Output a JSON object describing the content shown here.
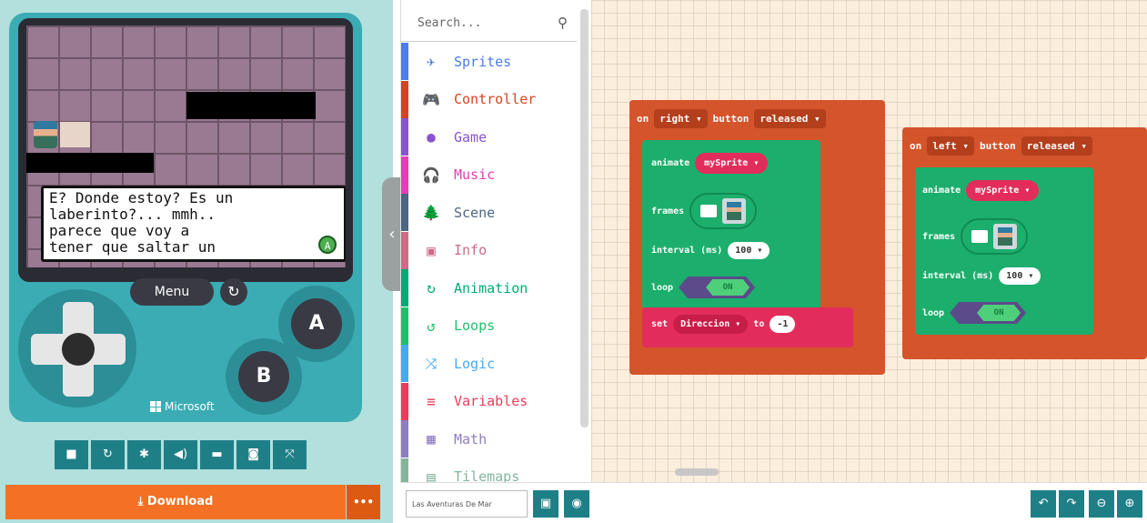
{
  "simulator": {
    "dialog_lines": [
      "E? Donde estoy? Es un",
      "laberinto?... mmh..",
      "parece que voy a",
      "tener que saltar un"
    ],
    "dialog_button": "A",
    "menu_label": "Menu",
    "button_a": "A",
    "button_b": "B",
    "brand": "Microsoft",
    "toolbar_icons": [
      "stop-icon",
      "restart-icon",
      "debug-icon",
      "sound-icon",
      "keyboard-icon",
      "screenshot-icon",
      "fullscreen-icon"
    ],
    "download_label": "Download",
    "more_label": "•••"
  },
  "toolbox": {
    "search_placeholder": "Search...",
    "categories": [
      {
        "label": "Sprites",
        "color": "#4b7bec",
        "icon": "✈"
      },
      {
        "label": "Controller",
        "color": "#d54322",
        "icon": "🎮"
      },
      {
        "label": "Game",
        "color": "#8854d0",
        "icon": "●"
      },
      {
        "label": "Music",
        "color": "#e63cb5",
        "icon": "🎧"
      },
      {
        "label": "Scene",
        "color": "#4b6584",
        "icon": "🌲"
      },
      {
        "label": "Info",
        "color": "#cf6a87",
        "icon": "▣"
      },
      {
        "label": "Animation",
        "color": "#03aa74",
        "icon": "↻"
      },
      {
        "label": "Loops",
        "color": "#20bf6b",
        "icon": "↺"
      },
      {
        "label": "Logic",
        "color": "#45aaf2",
        "icon": "⤨"
      },
      {
        "label": "Variables",
        "color": "#eb3b5a",
        "icon": "≡"
      },
      {
        "label": "Math",
        "color": "#8e7cc3",
        "icon": "▦"
      },
      {
        "label": "Tilemaps",
        "color": "#84b59c",
        "icon": "▤"
      }
    ]
  },
  "workspace": {
    "block1": {
      "on": "on",
      "button": "right ▾",
      "button_word": "button",
      "event": "released ▾",
      "animate": "animate",
      "sprite": "mySprite ▾",
      "frames": "frames",
      "interval": "interval (ms)",
      "interval_value": "100 ▾",
      "loop": "loop",
      "loop_value": "ON",
      "set": "set",
      "variable": "Direccion ▾",
      "to": "to",
      "value": "-1"
    },
    "block2": {
      "on": "on",
      "button": "left ▾",
      "button_word": "button",
      "event": "released ▾",
      "animate": "animate",
      "sprite": "mySprite ▾",
      "frames": "frames",
      "interval": "interval (ms)",
      "interval_value": "100 ▾",
      "loop": "loop",
      "loop_value": "ON"
    }
  },
  "bottom": {
    "project_name": "Las Aventuras De Mar"
  }
}
